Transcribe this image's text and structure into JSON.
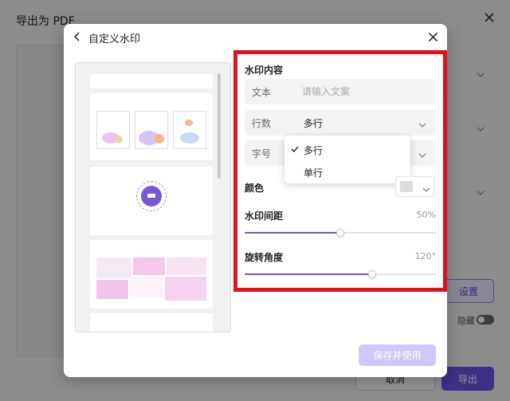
{
  "background_dialog": {
    "title": "导出为 PDF",
    "settings_button": "设置",
    "hide_label": "隐藏",
    "cancel_button": "取消",
    "export_button": "导出"
  },
  "watermark_modal": {
    "title": "自定义水印",
    "sections": {
      "content_label": "水印内容",
      "text_field": {
        "label": "文本",
        "placeholder": "请输入文案",
        "value": ""
      },
      "lines_field": {
        "label": "行数",
        "value": "多行"
      },
      "font_size_field": {
        "label": "字号",
        "value": ""
      },
      "color_label": "颜色",
      "color_value": "#dcdcde",
      "spacing": {
        "label": "水印间距",
        "value_text": "50%",
        "level": 0.5
      },
      "rotation": {
        "label": "旋转角度",
        "value_text": "120°",
        "level": 0.667
      }
    },
    "lines_dropdown": {
      "options": [
        "多行",
        "单行"
      ],
      "selected": "多行"
    },
    "save_button": "保存并使用"
  },
  "highlight_color": "#e3101c",
  "accent_color": "#6a55e6",
  "icons": {
    "back": "chevron-left-icon",
    "close": "close-icon",
    "check": "check-icon",
    "chevron": "chevron-down-icon"
  }
}
